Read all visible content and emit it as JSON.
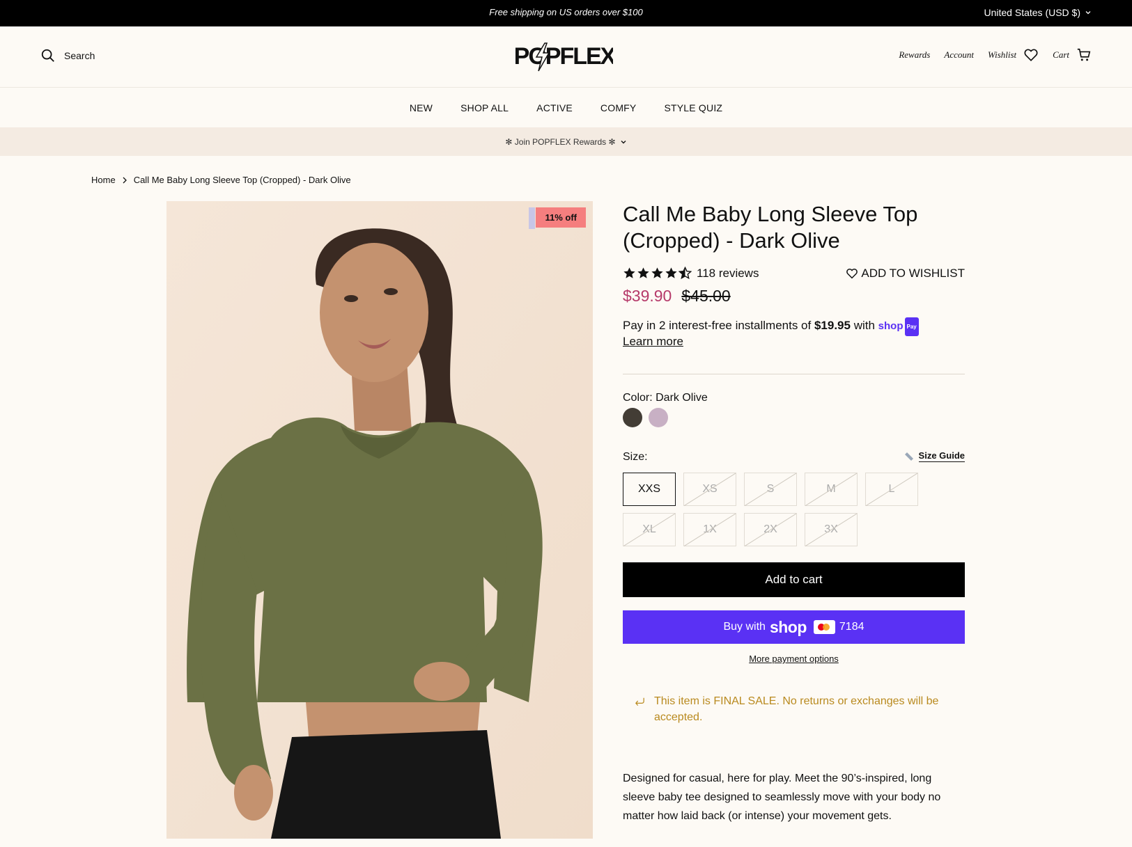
{
  "announcement": {
    "message": "Free shipping on US orders over $100",
    "country": "United States (USD $)"
  },
  "header": {
    "search_label": "Search",
    "logo_text": "POPFLEX",
    "rewards": "Rewards",
    "account": "Account",
    "wishlist": "Wishlist",
    "cart": "Cart"
  },
  "nav": {
    "items": [
      "NEW",
      "SHOP ALL",
      "ACTIVE",
      "COMFY",
      "STYLE QUIZ"
    ]
  },
  "rewards_bar": {
    "label": "✻ Join POPFLEX Rewards ✻"
  },
  "breadcrumb": {
    "home": "Home",
    "current": "Call Me Baby Long Sleeve Top (Cropped) - Dark Olive"
  },
  "gallery": {
    "badge": "11% off"
  },
  "product": {
    "title": "Call Me Baby Long Sleeve Top (Cropped) - Dark Olive",
    "rating": 4.5,
    "reviews": "118 reviews",
    "add_to_wishlist": "ADD TO WISHLIST",
    "sale_price": "$39.90",
    "original_price": "$45.00",
    "installments_pre": "Pay in 2 interest-free installments of ",
    "installment_amount": "$19.95",
    "installments_post": " with ",
    "shop_word": "shop",
    "shop_pay_tag": "Pay",
    "learn_more": "Learn more",
    "color_label": "Color: Dark Olive",
    "colors": [
      "#433d35",
      "#c8b0c4"
    ],
    "size_label": "Size:",
    "size_guide": "Size Guide",
    "sizes": [
      {
        "label": "XXS",
        "available": true
      },
      {
        "label": "XS",
        "available": false
      },
      {
        "label": "S",
        "available": false
      },
      {
        "label": "M",
        "available": false
      },
      {
        "label": "L",
        "available": false
      },
      {
        "label": "XL",
        "available": false
      },
      {
        "label": "1X",
        "available": false
      },
      {
        "label": "2X",
        "available": false
      },
      {
        "label": "3X",
        "available": false
      }
    ],
    "add_to_cart": "Add to cart",
    "buy_with": "Buy with",
    "buy_shop_word": "shop",
    "card_last4": "7184",
    "more_payment": "More payment options",
    "final_sale": "This item is FINAL SALE. No returns or exchanges will be accepted.",
    "description": "Designed for casual, here for play. Meet the 90’s-inspired, long sleeve baby tee designed to seamlessly move with your body no matter how laid back (or intense) your movement gets."
  }
}
